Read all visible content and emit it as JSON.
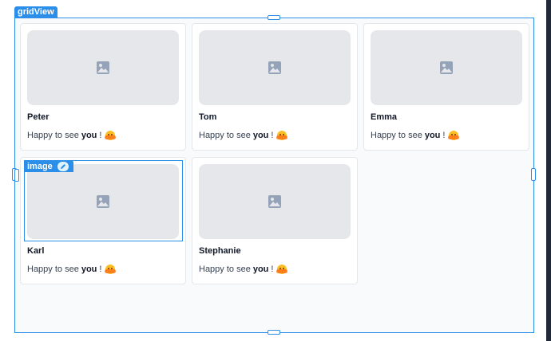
{
  "editor": {
    "gridview_label": "gridView",
    "image_label": "image"
  },
  "cards": [
    {
      "name": "Peter",
      "greeting_prefix": "Happy to see",
      "greeting_bold": "you",
      "greeting_suffix": "!",
      "emoji": "hugging-face-icon"
    },
    {
      "name": "Tom",
      "greeting_prefix": "Happy to see",
      "greeting_bold": "you",
      "greeting_suffix": "!",
      "emoji": "hugging-face-icon"
    },
    {
      "name": "Emma",
      "greeting_prefix": "Happy to see",
      "greeting_bold": "you",
      "greeting_suffix": "!",
      "emoji": "hugging-face-icon"
    },
    {
      "name": "Karl",
      "greeting_prefix": "Happy to see",
      "greeting_bold": "you",
      "greeting_suffix": "!",
      "emoji": "hugging-face-icon"
    },
    {
      "name": "Stephanie",
      "greeting_prefix": "Happy to see",
      "greeting_bold": "you",
      "greeting_suffix": "!",
      "emoji": "hugging-face-icon"
    }
  ],
  "colors": {
    "selection": "#2b8ee8",
    "image_placeholder": "#e5e7eb"
  }
}
